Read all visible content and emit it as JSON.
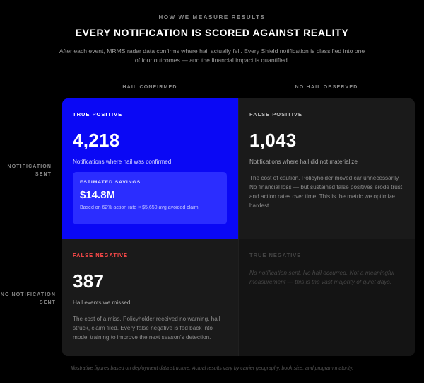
{
  "header": {
    "eyebrow": "HOW WE MEASURE RESULTS",
    "title": "EVERY NOTIFICATION IS SCORED AGAINST REALITY",
    "description": "After each event, MRMS radar data confirms where hail actually fell. Every Shield notification is classified into one of four outcomes — and the financial impact is quantified."
  },
  "columns": [
    "HAIL CONFIRMED",
    "NO HAIL OBSERVED"
  ],
  "rows": [
    {
      "line1": "NOTIFICATION",
      "line2": "SENT"
    },
    {
      "line1": "NO NOTIFICATION",
      "line2": "SENT"
    }
  ],
  "matrix": {
    "true_positive": {
      "label": "TRUE POSITIVE",
      "value": "4,218",
      "caption": "Notifications where hail was confirmed",
      "savings": {
        "label": "ESTIMATED SAVINGS",
        "value": "$14.8M",
        "note": "Based on 62% action rate × $5,650 avg avoided claim"
      }
    },
    "false_positive": {
      "label": "FALSE POSITIVE",
      "value": "1,043",
      "caption": "Notifications where hail did not materialize",
      "body": "The cost of caution. Policyholder moved car unnecessarily. No financial loss — but sustained false positives erode trust and action rates over time. This is the metric we optimize hardest."
    },
    "false_negative": {
      "label": "FALSE NEGATIVE",
      "value": "387",
      "caption": "Hail events we missed",
      "body": "The cost of a miss. Policyholder received no warning, hail struck, claim filed. Every false negative is fed back into model training to improve the next season's detection."
    },
    "true_negative": {
      "label": "TRUE NEGATIVE",
      "body": "No notification sent. No hail occurred. Not a meaningful measurement — this is the vast majority of quiet days."
    }
  },
  "footnote": "Illustrative figures based on deployment data structure. Actual results vary by carrier geography, book size, and program maturity.",
  "colors": {
    "background": "#000000",
    "true_positive": "#0a08f5",
    "savings_box": "#2b2dff",
    "false_negative_label": "#ff4a4a",
    "dark_cell": "#1a1a1a"
  }
}
